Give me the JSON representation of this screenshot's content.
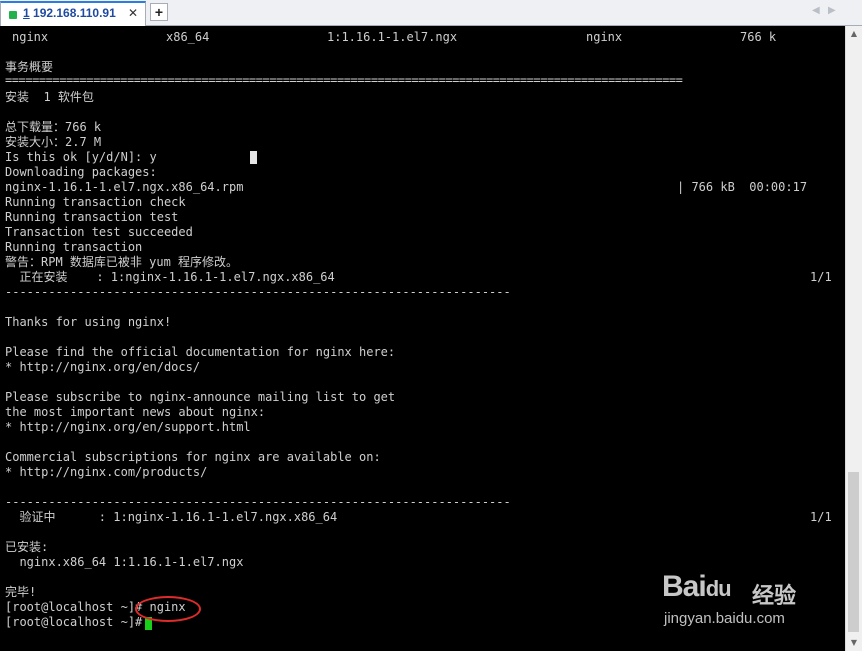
{
  "tab": {
    "index": "1",
    "host": "192.168.110.91",
    "close": "✕"
  },
  "newtab": "+",
  "nav": {
    "prev": "◀",
    "next": "▶"
  },
  "table_row": {
    "name": "nginx",
    "arch": "x86_64",
    "version": "1:1.16.1-1.el7.ngx",
    "repo": "nginx",
    "size": "766 k"
  },
  "lines": {
    "summary_title": "事务概要",
    "sep_double": "====================================================================================================",
    "install_count": "安装  1 软件包",
    "download_size": "总下载量：766 k",
    "installed_size": "安装大小：2.7 M",
    "is_ok": "Is this ok [y/d/N]: y",
    "downloading": "Downloading packages:",
    "rpm_file": "nginx-1.16.1-1.el7.ngx.x86_64.rpm",
    "rpm_progress": "| 766 kB  00:00:17",
    "run_check": "Running transaction check",
    "run_test": "Running transaction test",
    "test_ok": "Transaction test succeeded",
    "run_tx": "Running transaction",
    "warning": "警告：RPM 数据库已被非 yum 程序修改。",
    "installing": "  正在安装    : 1:nginx-1.16.1-1.el7.ngx.x86_64",
    "installing_count": "1/1",
    "sep_dash1": "----------------------------------------------------------------------",
    "thanks": "Thanks for using nginx!",
    "docs_intro": "Please find the official documentation for nginx here:",
    "docs_url": "* http://nginx.org/en/docs/",
    "subscribe1": "Please subscribe to nginx-announce mailing list to get",
    "subscribe2": "the most important news about nginx:",
    "support_url": "* http://nginx.org/en/support.html",
    "commercial": "Commercial subscriptions for nginx are available on:",
    "products_url": "* http://nginx.com/products/",
    "sep_dash2": "----------------------------------------------------------------------",
    "verifying": "  验证中      : 1:nginx-1.16.1-1.el7.ngx.x86_64",
    "verifying_count": "1/1",
    "installed_title": "已安装:",
    "installed_pkg": "  nginx.x86_64 1:1.16.1-1.el7.ngx",
    "done": "完毕!",
    "prompt1": "[root@localhost ~]# nginx",
    "prompt2": "[root@localhost ~]# "
  },
  "watermark": {
    "logo": "Bai",
    "logo2": "du",
    "cn": "经验",
    "url": "jingyan.baidu.com"
  },
  "colors": {
    "terminal_bg": "#000000",
    "terminal_fg": "#cfcfcf",
    "cursor": "#18d01a",
    "annotation_circle": "#e02b2b",
    "tab_accent": "#2b7de1"
  }
}
